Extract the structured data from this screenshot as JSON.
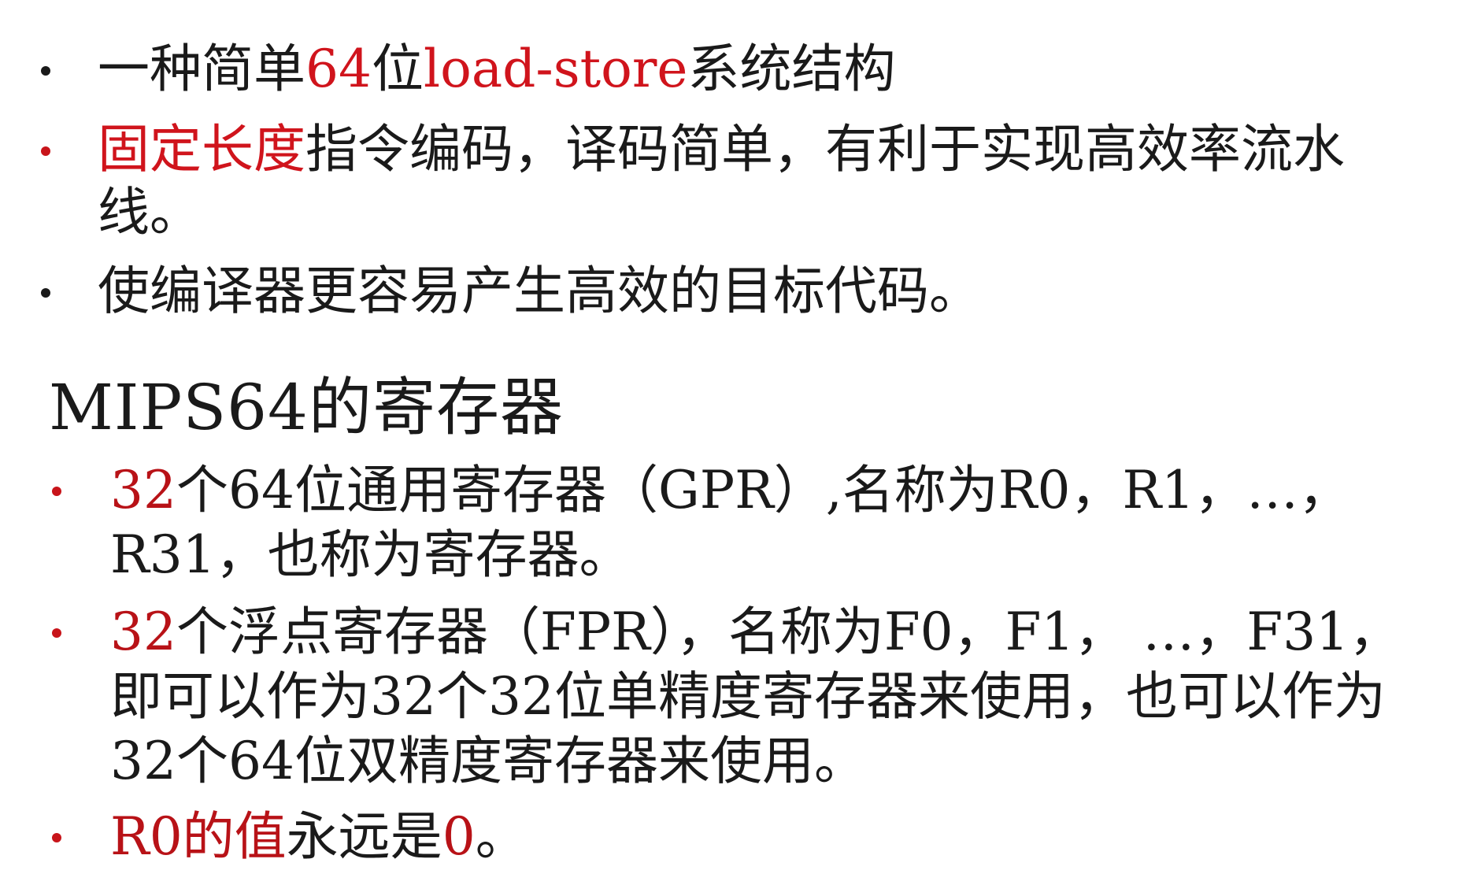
{
  "top_bullets": [
    {
      "parts": [
        {
          "text": "一种简单",
          "color": "#1a1a1a"
        },
        {
          "text": "64",
          "color": "#d0141c"
        },
        {
          "text": "位",
          "color": "#1a1a1a"
        },
        {
          "text": "load-store",
          "color": "#d0141c"
        },
        {
          "text": "系统结构",
          "color": "#1a1a1a"
        }
      ],
      "bullet_color": "#1a1a1a"
    },
    {
      "parts": [
        {
          "text": "固定长度",
          "color": "#d0141c"
        },
        {
          "text": "指令编码，译码简单，有利于实现高效率流水线。",
          "color": "#1a1a1a"
        }
      ],
      "bullet_color": "#d0141c"
    },
    {
      "parts": [
        {
          "text": "使编译器更容易产生高效的目标代码。",
          "color": "#1a1a1a"
        }
      ],
      "bullet_color": "#1a1a1a"
    }
  ],
  "section_heading": "MIPS64的寄存器",
  "bottom_bullets": [
    {
      "parts": [
        {
          "text": "32",
          "color": "#b81217"
        },
        {
          "text": "个64位通用寄存器（GPR）,名称为R0，R1，…，R31，也称为寄存器。",
          "color": "#1a1a1a"
        }
      ],
      "bullet_color": "#c8141a"
    },
    {
      "parts": [
        {
          "text": "32",
          "color": "#b81217"
        },
        {
          "text": "个浮点寄存器（FPR），名称为F0，F1， …，F31，即可以作为32个32位单精度寄存器来使用，也可以作为32个64位双精度寄存器来使用。",
          "color": "#1a1a1a"
        }
      ],
      "bullet_color": "#c8141a"
    },
    {
      "parts": [
        {
          "text": "R0的值",
          "color": "#b81217"
        },
        {
          "text": "永远是",
          "color": "#1a1a1a"
        },
        {
          "text": "0",
          "color": "#b81217"
        },
        {
          "text": "。",
          "color": "#1a1a1a"
        }
      ],
      "bullet_color": "#c8141a"
    }
  ]
}
